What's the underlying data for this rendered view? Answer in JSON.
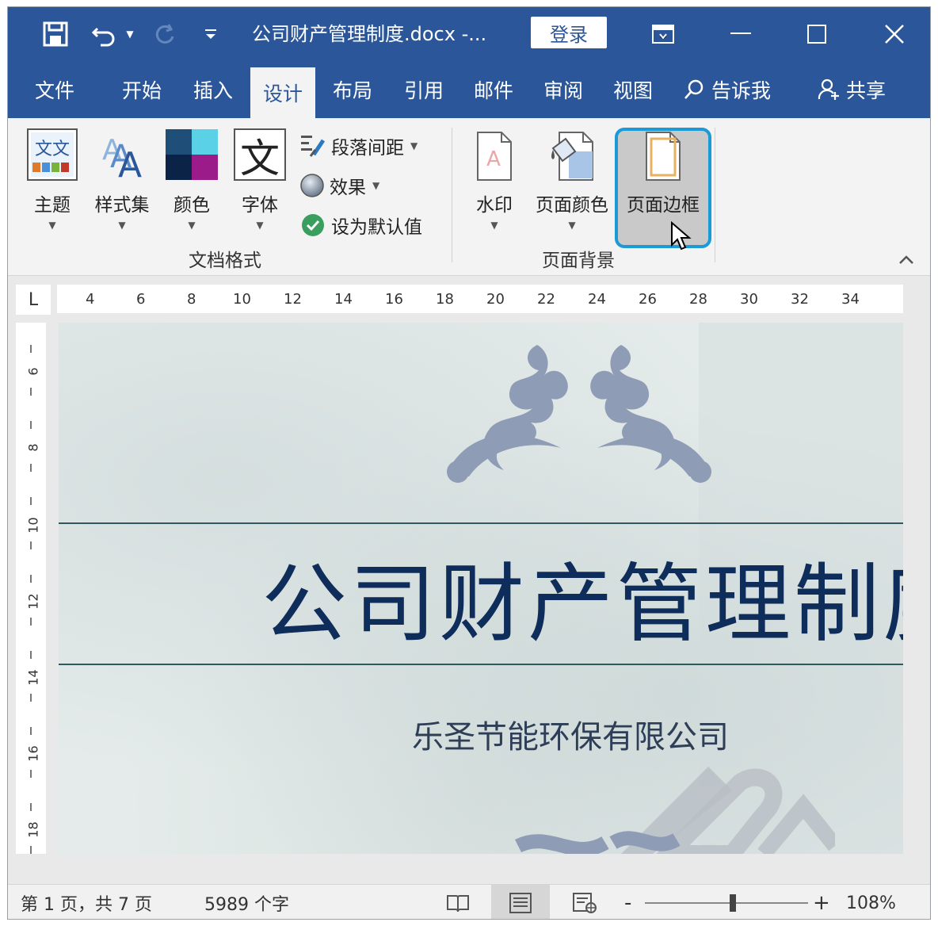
{
  "titlebar": {
    "doc_title": "公司财产管理制度.docx  -...",
    "login_label": "登录",
    "colors": {
      "bar": "#2b579a"
    }
  },
  "tabs": [
    {
      "label": "文件"
    },
    {
      "label": "开始"
    },
    {
      "label": "插入"
    },
    {
      "label": "设计",
      "active": true
    },
    {
      "label": "布局"
    },
    {
      "label": "引用"
    },
    {
      "label": "邮件"
    },
    {
      "label": "审阅"
    },
    {
      "label": "视图"
    },
    {
      "label": "告诉我"
    },
    {
      "label": "共享"
    }
  ],
  "ribbon": {
    "doc_format": {
      "group_label": "文档格式",
      "theme": "主题",
      "style_set": "样式集",
      "colors": "颜色",
      "fonts": "字体",
      "paragraph_spacing": "段落间距",
      "effects": "效果",
      "set_default": "设为默认值"
    },
    "page_background": {
      "group_label": "页面背景",
      "watermark": "水印",
      "page_color": "页面颜色",
      "page_borders": "页面边框"
    },
    "highlight_color": "#1a9ad6"
  },
  "ruler": {
    "h_ticks": [
      "4",
      "6",
      "8",
      "10",
      "12",
      "14",
      "16",
      "18",
      "20",
      "22",
      "24",
      "26",
      "28",
      "30",
      "32",
      "34"
    ],
    "v_ticks": [
      "6",
      "8",
      "10",
      "12",
      "14",
      "16",
      "18"
    ],
    "corner": "L"
  },
  "document": {
    "title": "公司财产管理制度",
    "subtitle": "乐圣节能环保有限公司"
  },
  "statusbar": {
    "page_info": "第 1 页，共 7 页",
    "word_count": "5989 个字",
    "zoom_minus": "-",
    "zoom_plus": "+",
    "zoom": "108%",
    "zoom_level": 0.54
  }
}
